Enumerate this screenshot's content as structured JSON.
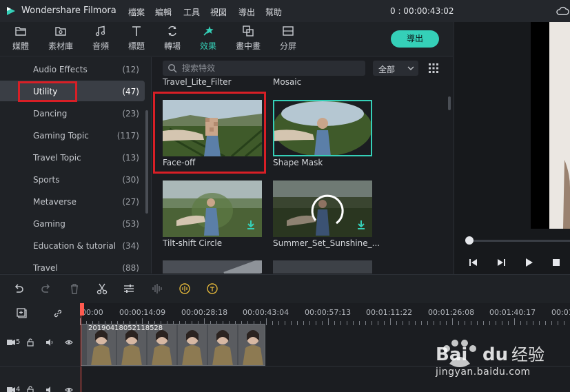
{
  "titlebar": {
    "app_title": "Wondershare Filmora",
    "menu": [
      "檔案",
      "編輯",
      "工具",
      "視図",
      "導出",
      "幫助"
    ],
    "timecode": "0 : 00:00:43:02"
  },
  "toolbar": {
    "tools": [
      {
        "label": "媒體",
        "icon": "folder-icon"
      },
      {
        "label": "素材庫",
        "icon": "image-folder-icon"
      },
      {
        "label": "音頻",
        "icon": "music-note-icon"
      },
      {
        "label": "標題",
        "icon": "text-icon"
      },
      {
        "label": "轉場",
        "icon": "transition-icon"
      },
      {
        "label": "效果",
        "icon": "effects-icon",
        "active": true
      },
      {
        "label": "畫中畫",
        "icon": "pip-icon"
      },
      {
        "label": "分屏",
        "icon": "split-screen-icon"
      }
    ],
    "export_label": "導出",
    "accent_color": "#35d0b8"
  },
  "sidebar": {
    "categories": [
      {
        "label": "Audio Effects",
        "count": "(12)"
      },
      {
        "label": "Utility",
        "count": "(47)",
        "selected": true
      },
      {
        "label": "Dancing",
        "count": "(23)"
      },
      {
        "label": "Gaming Topic",
        "count": "(117)"
      },
      {
        "label": "Travel Topic",
        "count": "(13)"
      },
      {
        "label": "Sports",
        "count": "(30)"
      },
      {
        "label": "Metaverse",
        "count": "(27)"
      },
      {
        "label": "Gaming",
        "count": "(53)"
      },
      {
        "label": "Education & tutorial",
        "count": "(34)"
      },
      {
        "label": "Travel",
        "count": "(88)"
      }
    ]
  },
  "effects": {
    "search_placeholder": "搜索特效",
    "filter_value": "全部",
    "cards": [
      {
        "title": "Travel_Lite_Filter"
      },
      {
        "title": "Mosaic"
      },
      {
        "title": "Face-off",
        "highlighted": true
      },
      {
        "title": "Shape Mask",
        "selected": true
      },
      {
        "title": "Tilt-shift Circle",
        "downloadable": true
      },
      {
        "title": "Summer_Set_Sunshine_...",
        "downloadable": true
      }
    ]
  },
  "timeline": {
    "ruler": [
      "00:00",
      "00:00:14:09",
      "00:00:28:18",
      "00:00:43:04",
      "00:00:57:13",
      "00:01:11:22",
      "00:01:26:08",
      "00:01:40:17",
      "00:01"
    ],
    "clip_label": "20190418052118528",
    "tracks": [
      {
        "number": "5"
      },
      {
        "number": "4"
      }
    ],
    "playhead_color": "#ff5a4f"
  },
  "watermark": {
    "brand": "Bai du 经验",
    "url": "jingyan.baidu.com"
  }
}
